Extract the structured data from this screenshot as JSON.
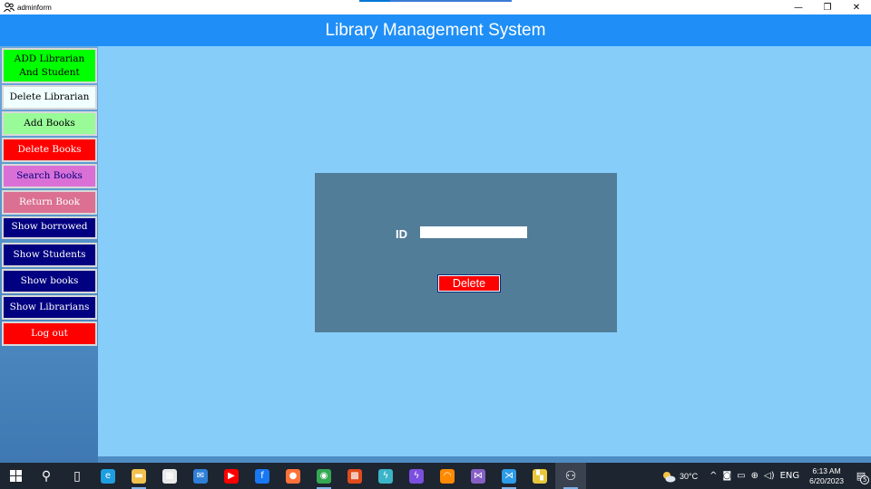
{
  "window": {
    "title": "adminform",
    "minimize_glyph": "—",
    "restore_glyph": "❐",
    "close_glyph": "✕"
  },
  "header": {
    "title": "Library Management System"
  },
  "sidebar": {
    "items": [
      {
        "label": "ADD Librarian\nAnd Student",
        "bg": "#00ff00",
        "color": "#000000"
      },
      {
        "label": "Delete Librarian",
        "bg": "#f0ffff",
        "color": "#000000"
      },
      {
        "label": "Add Books",
        "bg": "#98fb98",
        "color": "#000000"
      },
      {
        "label": "Delete Books",
        "bg": "#ff0000",
        "color": "#ffffff"
      },
      {
        "label": "Search Books",
        "bg": "#da70d6",
        "color": "#000080"
      },
      {
        "label": "Return Book",
        "bg": "#db7093",
        "color": "#ffffff"
      },
      {
        "label": "Show borrowed",
        "bg": "#000080",
        "color": "#ffffff"
      },
      {
        "label": "Show Students",
        "bg": "#000080",
        "color": "#ffffff"
      },
      {
        "label": "Show books",
        "bg": "#000080",
        "color": "#ffffff"
      },
      {
        "label": "Show Librarians",
        "bg": "#000080",
        "color": "#ffffff"
      },
      {
        "label": "Log out",
        "bg": "#ff0000",
        "color": "#ffffff"
      }
    ]
  },
  "form": {
    "id_label": "ID",
    "id_value": "",
    "delete_label": "Delete"
  },
  "taskbar": {
    "apps": [
      {
        "name": "search-icon",
        "glyph": "⚲",
        "color": "transparent"
      },
      {
        "name": "task-view-icon",
        "glyph": "▯",
        "color": "transparent"
      },
      {
        "name": "edge-icon",
        "glyph": "e",
        "color": "#1e9ee0"
      },
      {
        "name": "file-explorer-icon",
        "glyph": "▬",
        "color": "#f2c14e"
      },
      {
        "name": "store-icon",
        "glyph": "▦",
        "color": "#e9e9e9"
      },
      {
        "name": "mail-icon",
        "glyph": "✉",
        "color": "#2f7fd8"
      },
      {
        "name": "youtube-icon",
        "glyph": "▶",
        "color": "#ff0000"
      },
      {
        "name": "facebook-icon",
        "glyph": "f",
        "color": "#1877f2"
      },
      {
        "name": "firefox-icon",
        "glyph": "●",
        "color": "#ff7139"
      },
      {
        "name": "chrome-icon",
        "glyph": "◉",
        "color": "#34a853"
      },
      {
        "name": "office-icon",
        "glyph": "▩",
        "color": "#e04b1c"
      },
      {
        "name": "app-bolt-icon",
        "glyph": "ϟ",
        "color": "#3cb4c8"
      },
      {
        "name": "app-purple-bolt-icon",
        "glyph": "ϟ",
        "color": "#7b4fe0"
      },
      {
        "name": "app-orange-ring-icon",
        "glyph": "◠",
        "color": "#ff8a00"
      },
      {
        "name": "visual-studio-icon",
        "glyph": "⋈",
        "color": "#865fc5"
      },
      {
        "name": "vscode-icon",
        "glyph": "⋊",
        "color": "#2c9be8"
      },
      {
        "name": "app-yellow-icon",
        "glyph": "▚",
        "color": "#e8c73a"
      },
      {
        "name": "adminform-app-icon",
        "glyph": "⚇",
        "color": "transparent"
      }
    ],
    "weather": "30°C",
    "language": "ENG",
    "time": "6:13 AM",
    "date": "6/20/2023",
    "notification_count": "5"
  }
}
